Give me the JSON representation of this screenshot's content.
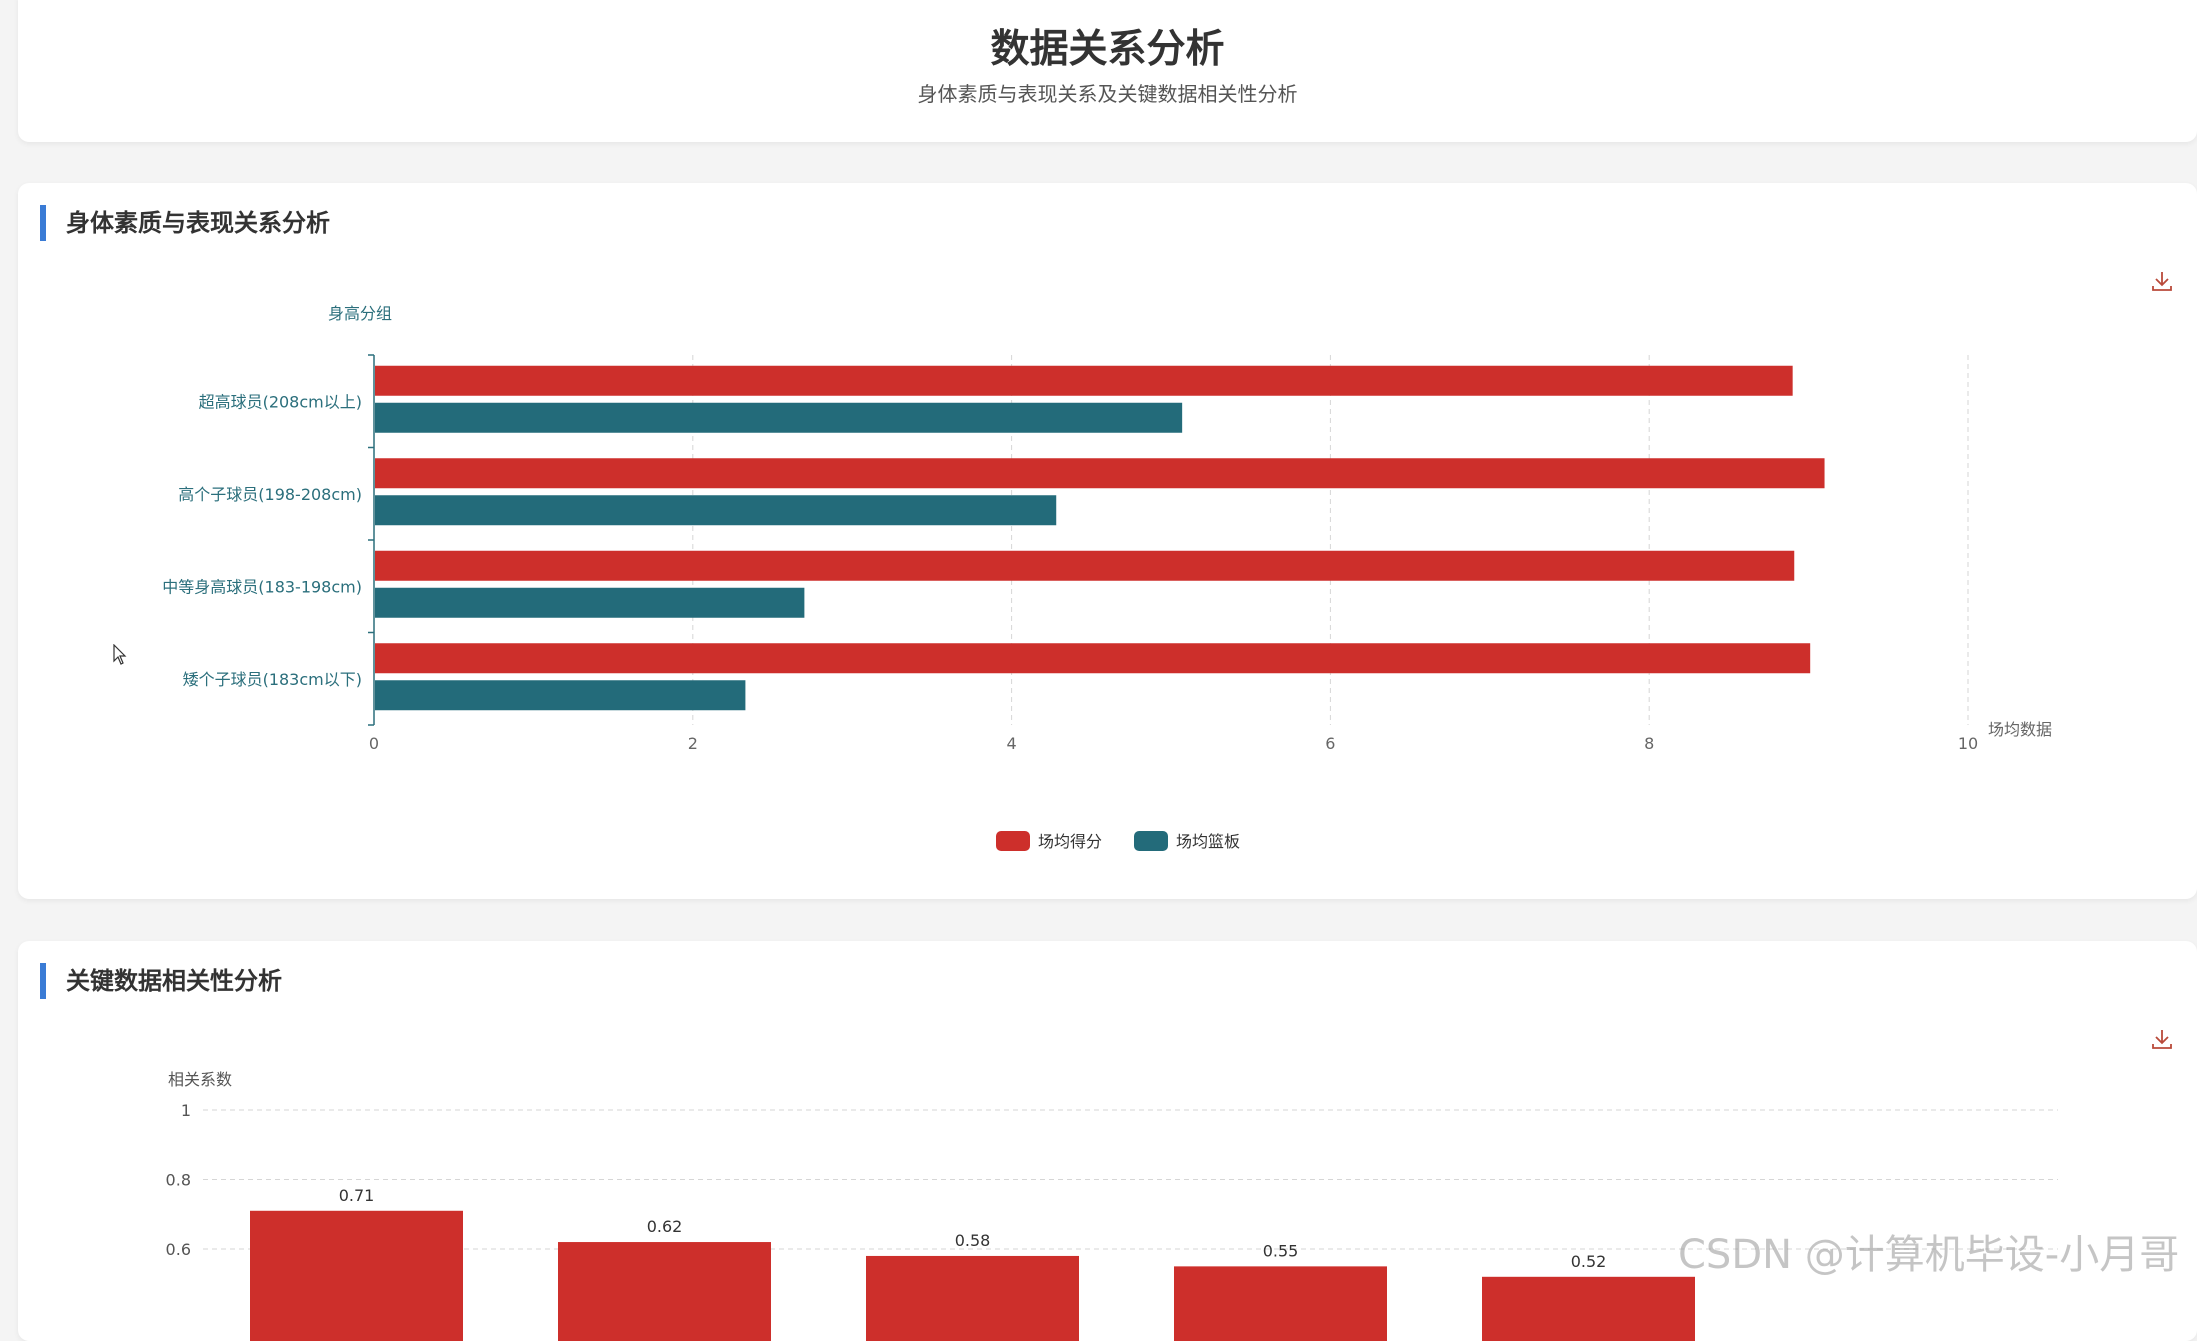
{
  "header": {
    "title": "数据关系分析",
    "subtitle": "身体素质与表现关系及关键数据相关性分析"
  },
  "section1": {
    "title": "身体素质与表现关系分析",
    "download_icon": "download-icon"
  },
  "section2": {
    "title": "关键数据相关性分析",
    "download_icon": "download-icon"
  },
  "watermark": "CSDN @计算机毕设-小月哥",
  "colors": {
    "accent": "#3a7bd5",
    "red": "#cd2f2b",
    "teal": "#236b7a"
  },
  "chart_data": [
    {
      "type": "bar",
      "orientation": "horizontal",
      "categories": [
        "超高球员(208cm以上)",
        "高个子球员(198-208cm)",
        "中等身高球员(183-198cm)",
        "矮个子球员(183cm以下)"
      ],
      "series": [
        {
          "name": "场均得分",
          "values": [
            8.9,
            9.1,
            8.91,
            9.01
          ]
        },
        {
          "name": "场均篮板",
          "values": [
            5.07,
            4.28,
            2.7,
            2.33
          ]
        }
      ],
      "ylabel": "身高分组",
      "xlabel": "场均数据",
      "xlim": [
        0,
        10
      ],
      "x_ticks": [
        "0",
        "2",
        "4",
        "6",
        "8",
        "10"
      ],
      "grid": true,
      "legend": "bottom-center"
    },
    {
      "type": "bar",
      "values": [
        0.71,
        0.62,
        0.58,
        0.55,
        0.52
      ],
      "data_labels": [
        "0.71",
        "0.62",
        "0.58",
        "0.55",
        "0.52"
      ],
      "ylabel": "相关系数",
      "y_ticks": [
        "1",
        "0.8",
        "0.6"
      ],
      "grid": true
    }
  ]
}
